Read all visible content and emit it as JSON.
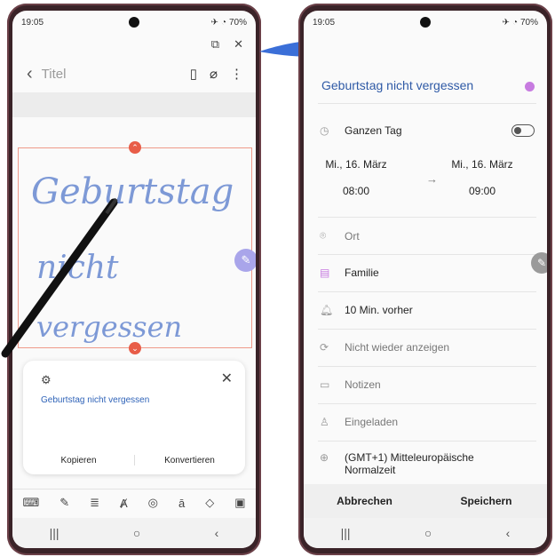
{
  "left_phone": {
    "status": {
      "time": "19:05",
      "battery": "70%"
    },
    "note_title_placeholder": "Titel",
    "handwriting": [
      "Geburtstag",
      "nicht",
      "vergessen"
    ],
    "card": {
      "recognized_text": "Geburtstag nicht vergessen",
      "copy_label": "Kopieren",
      "convert_label": "Konvertieren"
    },
    "toolbar_icons": [
      "keyboard-icon",
      "pen-icon",
      "text-format-icon",
      "style-icon",
      "fingerprint-pen-icon",
      "text-convert-icon",
      "shapes-icon",
      "lock-icon"
    ]
  },
  "right_phone": {
    "status": {
      "time": "19:05",
      "battery": "70%"
    },
    "event_title": "Geburtstag nicht vergessen",
    "color_dot": "#c77be0",
    "all_day_label": "Ganzen Tag",
    "start": {
      "date": "Mi., 16. März",
      "time": "08:00"
    },
    "end": {
      "date": "Mi., 16. März",
      "time": "09:00"
    },
    "location_placeholder": "Ort",
    "calendar": "Familie",
    "reminder": "10 Min. vorher",
    "repeat": "Nicht wieder anzeigen",
    "notes_placeholder": "Notizen",
    "invited_placeholder": "Eingeladen",
    "timezone_line1": "(GMT+1) Mitteleuropäische",
    "timezone_line2": "Normalzeit",
    "cancel_label": "Abbrechen",
    "save_label": "Speichern"
  }
}
